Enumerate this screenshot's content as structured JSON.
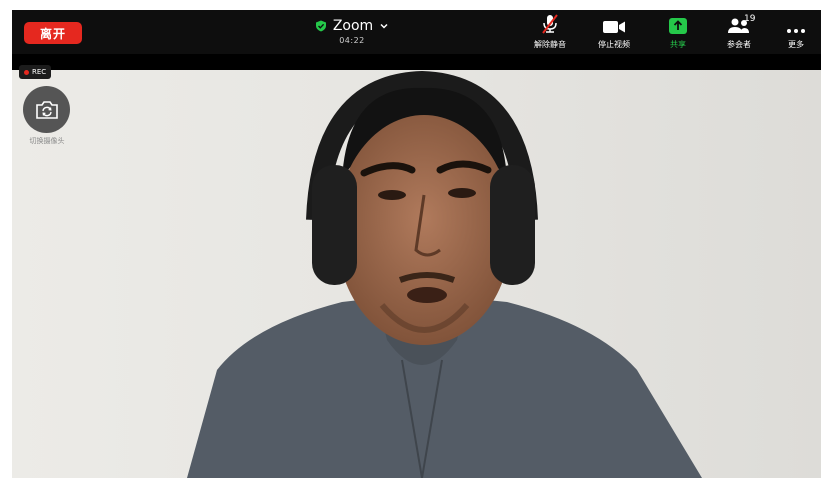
{
  "toolbar": {
    "leave_label": "离开",
    "meeting_title": "Zoom",
    "timer": "04:22",
    "mute_label": "解除静音",
    "video_label": "停止视频",
    "share_label": "共享",
    "participants_label": "参会者",
    "participants_count": "19",
    "more_label": "更多"
  },
  "overlay": {
    "rec_label": "REC",
    "switch_camera_label": "切换摄像头"
  },
  "icons": [
    "shield-check-icon",
    "chevron-down-icon",
    "mic-muted-icon",
    "video-camera-icon",
    "share-arrow-icon",
    "participants-icon",
    "more-dots-icon",
    "camera-switch-icon",
    "rec-dot-icon"
  ],
  "colors": {
    "leave": "#e5281f",
    "share": "#25c84a",
    "shield": "#25c84a",
    "toolbar_bg": "#0e0e0e"
  }
}
